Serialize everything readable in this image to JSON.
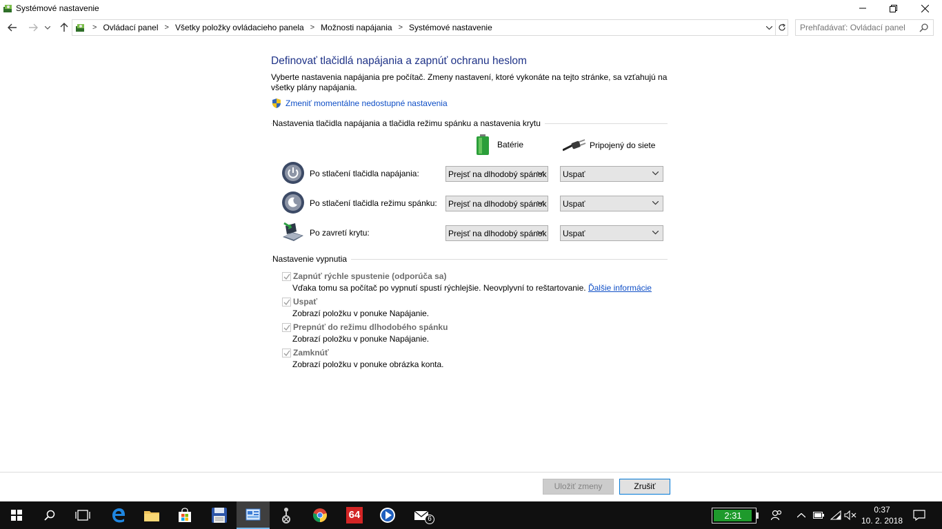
{
  "window": {
    "title": "Systémové nastavenie",
    "controls": {
      "minimize": "–",
      "maximize": "❐",
      "close": "✕"
    }
  },
  "address": {
    "crumbs": [
      "Ovládací panel",
      "Všetky položky ovládacieho panela",
      "Možnosti napájania",
      "Systémové nastavenie"
    ],
    "search_placeholder": "Prehľadávať: Ovládací panel"
  },
  "page": {
    "heading": "Definovať tlačidlá napájania a zapnúť ochranu heslom",
    "description": "Vyberte nastavenia napájania pre počítač. Zmeny nastavení, ktoré vykonáte na tejto stránke, sa vzťahujú na všetky plány napájania.",
    "change_link": "Zmeniť momentálne nedostupné nastavenia"
  },
  "buttons_section": {
    "title": "Nastavenia tlačidla napájania a tlačidla režimu spánku a nastavenia krytu",
    "col_battery": "Batérie",
    "col_plugged": "Pripojený do siete",
    "rows": [
      {
        "label": "Po stlačení tlačidla napájania:",
        "battery": "Prejsť na dlhodobý spánok",
        "plugged": "Uspať"
      },
      {
        "label": "Po stlačení tlačidla režimu spánku:",
        "battery": "Prejsť na dlhodobý spánok",
        "plugged": "Uspať"
      },
      {
        "label": "Po zavretí krytu:",
        "battery": "Prejsť na dlhodobý spánok",
        "plugged": "Uspať"
      }
    ]
  },
  "shutdown_section": {
    "title": "Nastavenie vypnutia",
    "items": [
      {
        "label": "Zapnúť rýchle spustenie (odporúča sa)",
        "desc": "Vďaka tomu sa počítač po vypnutí spustí rýchlejšie. Neovplyvní to reštartovanie.",
        "link": "Ďalšie informácie",
        "checked": true
      },
      {
        "label": "Uspať",
        "desc": "Zobrazí položku v ponuke Napájanie.",
        "checked": true
      },
      {
        "label": "Prepnúť do režimu dlhodobého spánku",
        "desc": "Zobrazí položku v ponuke Napájanie.",
        "checked": true
      },
      {
        "label": "Zamknúť",
        "desc": "Zobrazí položku v ponuke obrázka konta.",
        "checked": true
      }
    ]
  },
  "footer": {
    "save_label": "Uložiť zmeny",
    "cancel_label": "Zrušiť"
  },
  "taskbar": {
    "battery_time": "2:31",
    "time": "0:37",
    "date": "10. 2. 2018",
    "mail_badge": "6",
    "app_64_label": "64"
  },
  "colors": {
    "heading": "#1e3287",
    "link": "#0e4ec6",
    "taskbar": "#101010",
    "battery_green": "#1e9a2c"
  }
}
